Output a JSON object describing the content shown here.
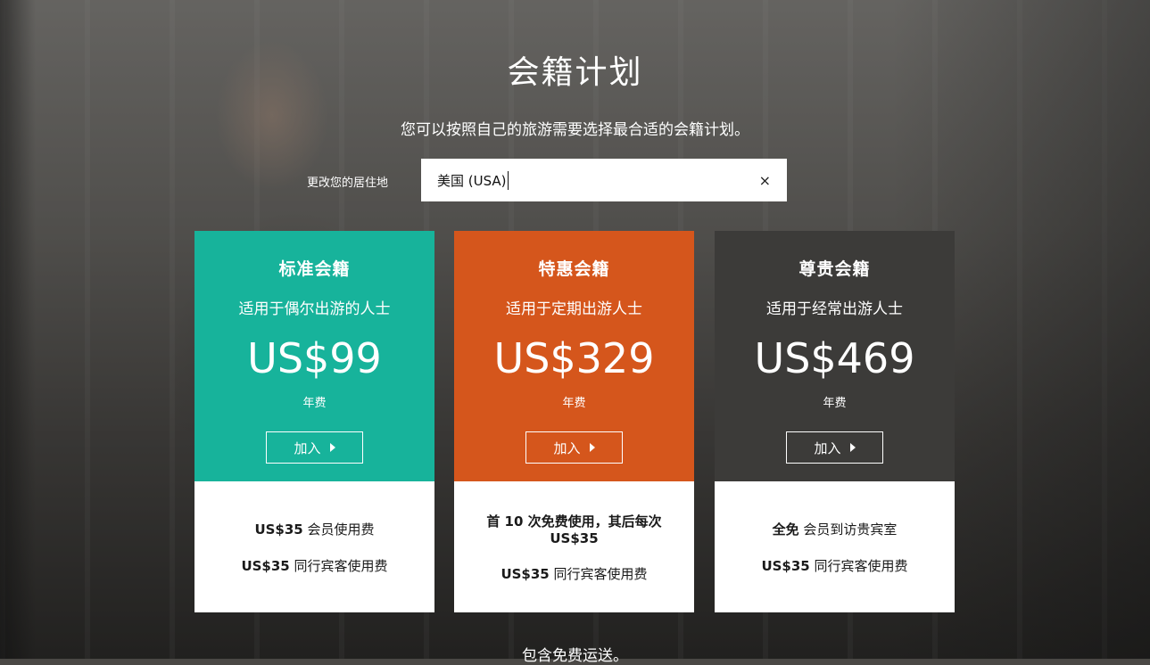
{
  "header": {
    "title": "会籍计划",
    "subtitle": "您可以按照自己的旅游需要选择最合适的会籍计划。"
  },
  "residence": {
    "label": "更改您的居住地",
    "value": "美国 (USA)",
    "clear_icon": "×"
  },
  "plans": [
    {
      "name": "标准会籍",
      "description": "适用于偶尔出游的人士",
      "price": "US$99",
      "period": "年费",
      "join_label": "加入",
      "color": "#17b39b",
      "benefits": [
        {
          "bold": "US$35",
          "text": " 会员使用费"
        },
        {
          "bold": "US$35",
          "text": " 同行宾客使用费"
        }
      ]
    },
    {
      "name": "特惠会籍",
      "description": "适用于定期出游人士",
      "price": "US$329",
      "period": "年费",
      "join_label": "加入",
      "color": "#d5561c",
      "benefits": [
        {
          "bold": "首 10 次免费使用，其后每次 US$35",
          "text": ""
        },
        {
          "bold": "US$35",
          "text": " 同行宾客使用费"
        }
      ]
    },
    {
      "name": "尊贵会籍",
      "description": "适用于经常出游人士",
      "price": "US$469",
      "period": "年费",
      "join_label": "加入",
      "color": "#3c3b39",
      "benefits": [
        {
          "bold": "全免",
          "text": " 会员到访贵宾室"
        },
        {
          "bold": "US$35",
          "text": " 同行宾客使用费"
        }
      ]
    }
  ],
  "footer": {
    "note": "包含免费运送。"
  }
}
